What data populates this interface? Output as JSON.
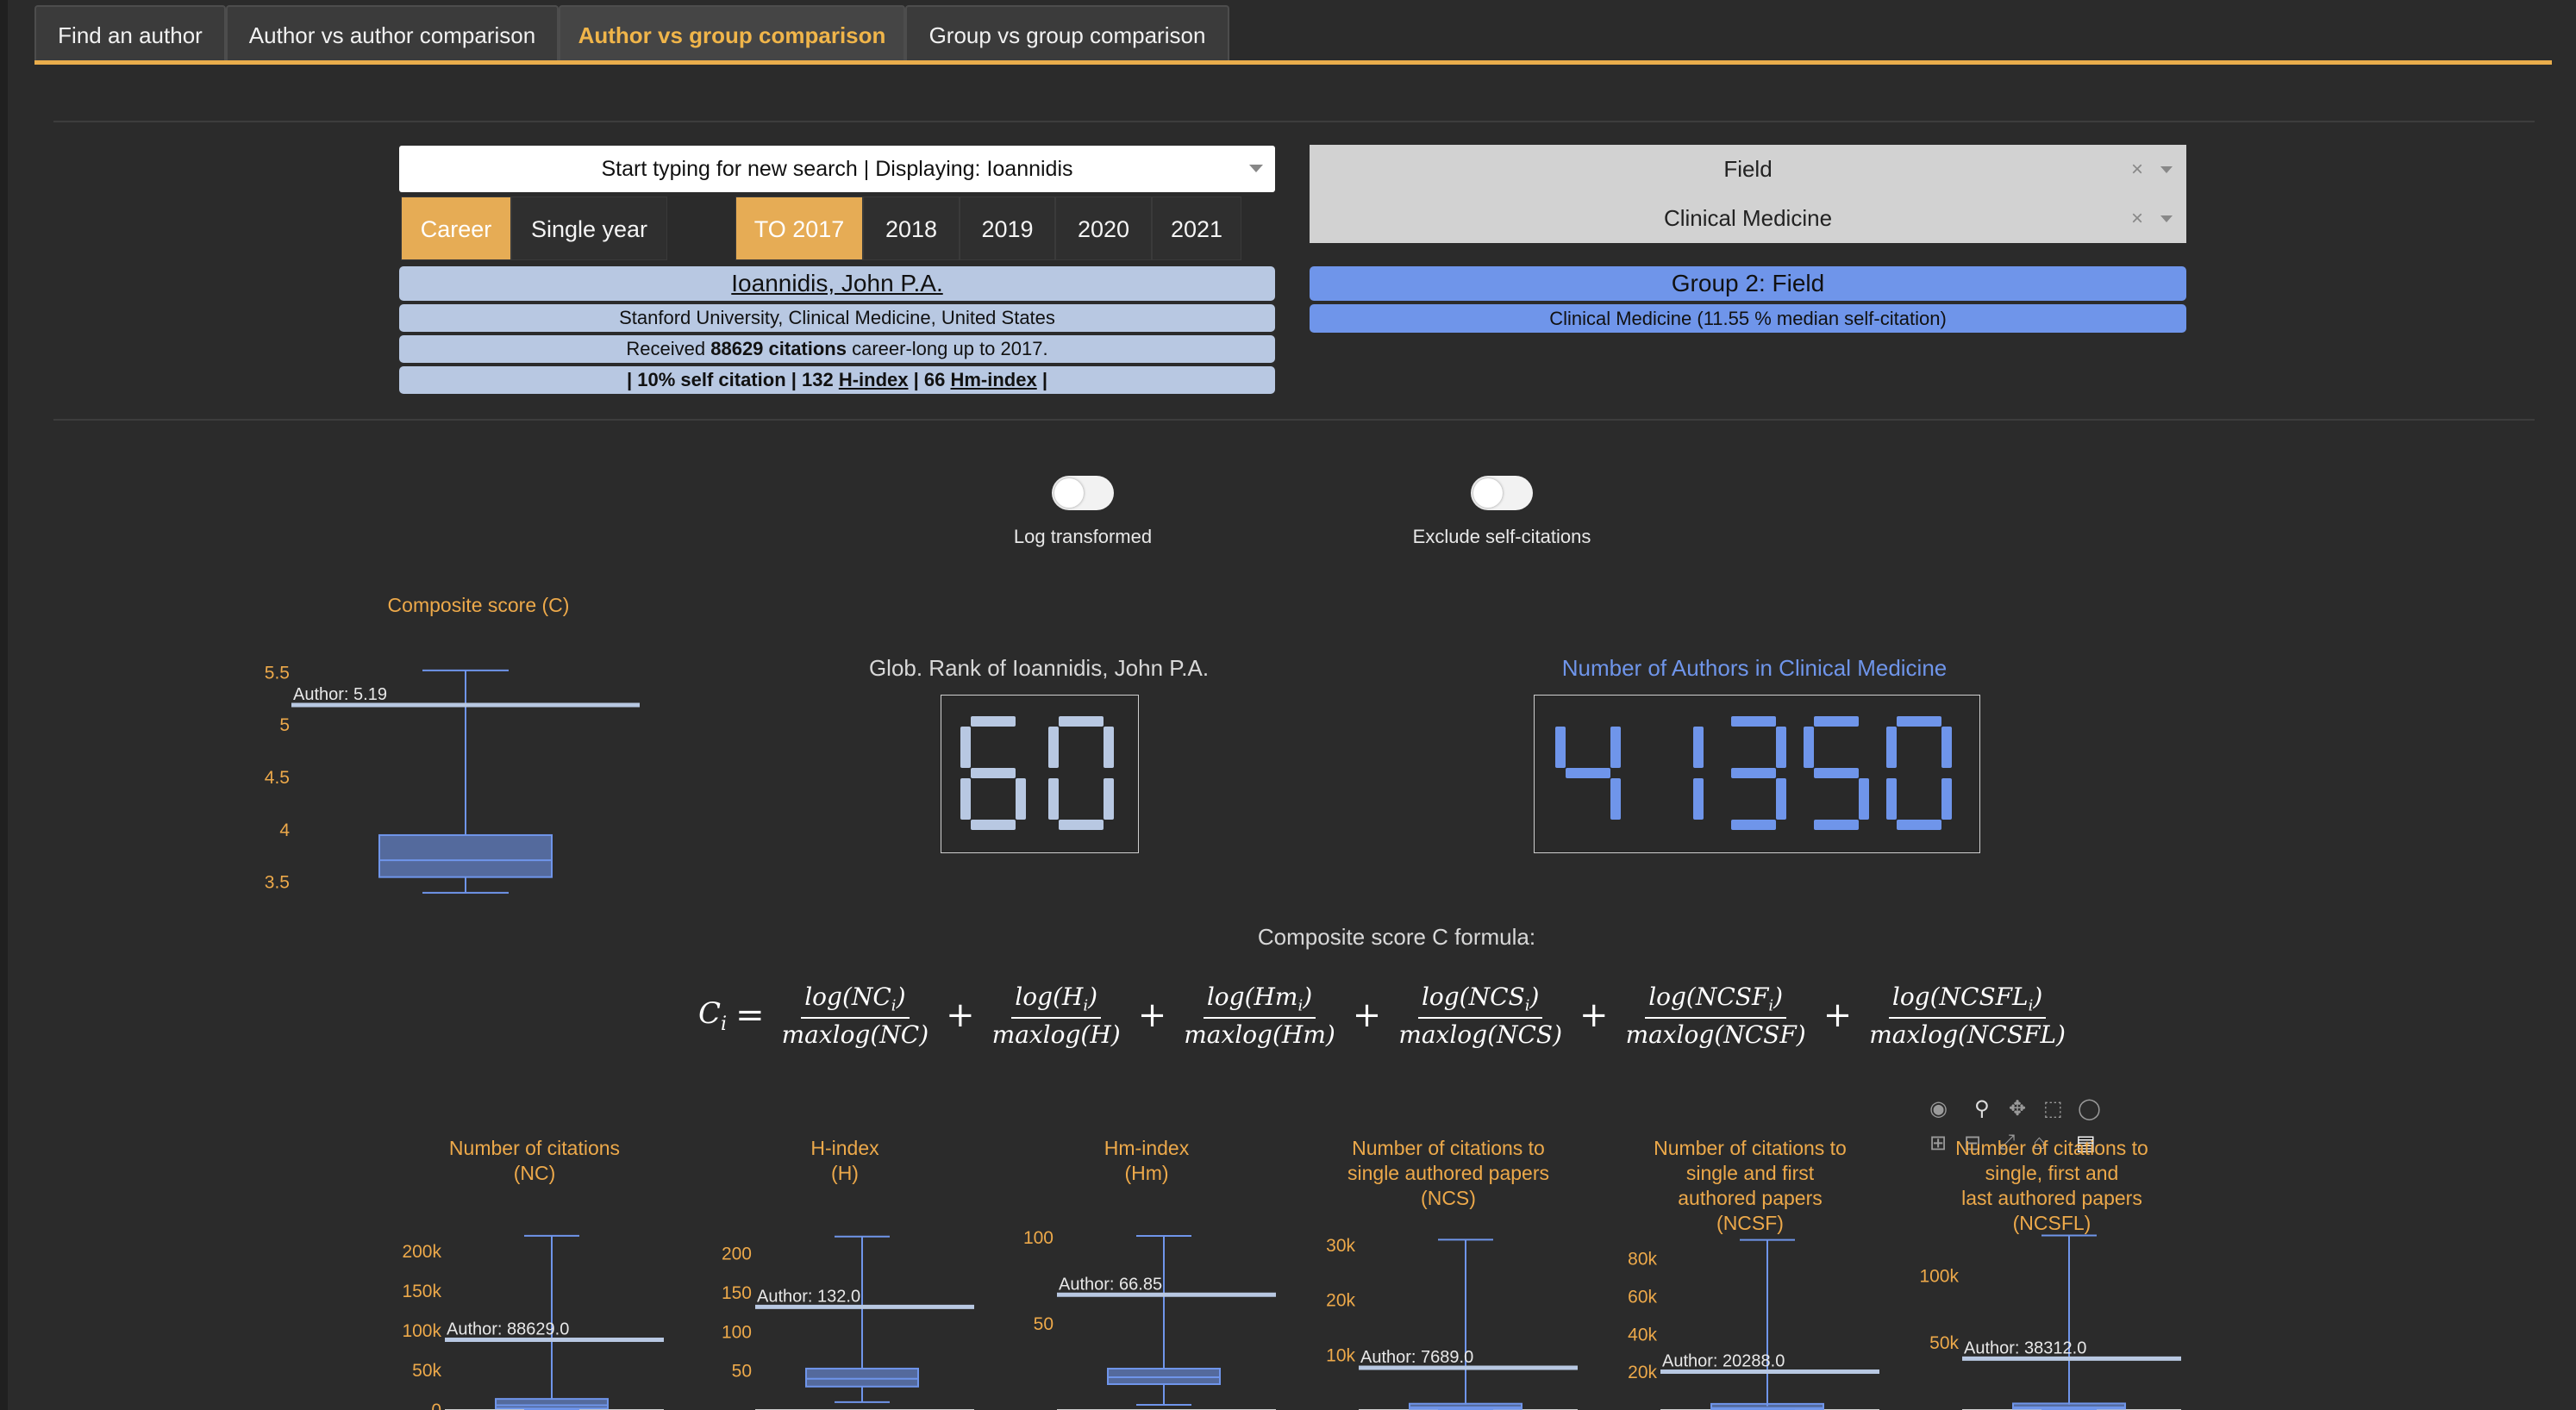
{
  "tabs": [
    "Find an author",
    "Author vs author comparison",
    "Author vs group comparison",
    "Group vs group comparison"
  ],
  "search": {
    "text": "Start typing for new search | Displaying: Ioannidis"
  },
  "mode_buttons": [
    "Career",
    "Single year"
  ],
  "year_buttons": [
    "TO 2017",
    "2018",
    "2019",
    "2020",
    "2021"
  ],
  "author": {
    "name": "Ioannidis, John P.A.",
    "affiliation": "Stanford University, Clinical Medicine, United States",
    "citations_prefix": "Received ",
    "citations_value": "88629 citations",
    "citations_suffix": " career-long up to 2017.",
    "stats_1": "| 10% self citation | 132 ",
    "stats_h": "H-index",
    "stats_2": " | 66 ",
    "stats_hm": "Hm-index",
    "stats_3": " |"
  },
  "group": {
    "select_1": "Field",
    "select_2": "Clinical Medicine",
    "clear_glyph": "×",
    "title": "Group 2: Field",
    "subtitle": "Clinical Medicine (11.55 % median self-citation)"
  },
  "toggles": {
    "log": "Log transformed",
    "self": "Exclude self-citations"
  },
  "rank": {
    "title": "Glob. Rank of Ioannidis, John P.A.",
    "value": "60"
  },
  "authors_count": {
    "title": "Number of Authors in Clinical Medicine",
    "value": "41350"
  },
  "formula_title": "Composite score C formula:",
  "formula": {
    "lhs": "C",
    "lhs_sub": "i",
    "eq": "=",
    "plus": "+",
    "terms": [
      {
        "num": "log(NC",
        "den": "maxlog(NC)"
      },
      {
        "num": "log(H",
        "den": "maxlog(H)"
      },
      {
        "num": "log(Hm",
        "den": "maxlog(Hm)"
      },
      {
        "num": "log(NCS",
        "den": "maxlog(NCS)"
      },
      {
        "num": "log(NCSF",
        "den": "maxlog(NCSF)"
      },
      {
        "num": "log(NCSFL",
        "den": "maxlog(NCSFL)"
      }
    ],
    "sub": "i",
    "close": ")"
  },
  "colors": {
    "accent": "#e9ad4c",
    "blue": "#6f95ea",
    "lightblue": "#b8c8e2",
    "lcd_light": "#b8c8e2",
    "lcd_blue": "#6f95ea"
  },
  "chart_data": [
    {
      "type": "box",
      "title": "Composite score (C)",
      "yticks": [
        "5.5",
        "5",
        "4.5",
        "4",
        "3.5"
      ],
      "ytick_values": [
        5.5,
        5,
        4.5,
        4,
        3.5
      ],
      "ylim": [
        3.35,
        5.65
      ],
      "box": {
        "min": 3.4,
        "q1": 3.55,
        "median": 3.71,
        "q3": 3.95,
        "max": 5.52
      },
      "author": 5.19,
      "author_label": "Author: 5.19"
    },
    {
      "type": "box",
      "title": "Number of citations\n(NC)",
      "yticks": [
        "200k",
        "150k",
        "100k",
        "50k",
        "0"
      ],
      "ytick_values": [
        200000,
        150000,
        100000,
        50000,
        0
      ],
      "ylim": [
        0,
        222000
      ],
      "box": {
        "min": 0,
        "q1": 2000,
        "median": 6000,
        "q3": 14000,
        "max": 220000
      },
      "author": 88629,
      "author_label": "Author: 88629.0"
    },
    {
      "type": "box",
      "title": "H-index\n(H)",
      "yticks": [
        "200",
        "150",
        "100",
        "50"
      ],
      "ytick_values": [
        200,
        150,
        100,
        50
      ],
      "ylim": [
        0,
        225
      ],
      "box": {
        "min": 10,
        "q1": 30,
        "median": 40,
        "q3": 53,
        "max": 222
      },
      "author": 132,
      "author_label": "Author: 132.0"
    },
    {
      "type": "box",
      "title": "Hm-index\n(Hm)",
      "yticks": [
        "100",
        "50"
      ],
      "ytick_values": [
        100,
        50
      ],
      "ylim": [
        0,
        102
      ],
      "box": {
        "min": 3,
        "q1": 15,
        "median": 19,
        "q3": 24,
        "max": 101
      },
      "author": 66.85,
      "author_label": "Author: 66.85"
    },
    {
      "type": "box",
      "title": "Number of citations to\nsingle authored papers\n(NCS)",
      "yticks": [
        "30k",
        "20k",
        "10k"
      ],
      "ytick_values": [
        30000,
        20000,
        10000
      ],
      "ylim": [
        0,
        32000
      ],
      "box": {
        "min": 0,
        "q1": 200,
        "median": 500,
        "q3": 1000,
        "max": 31000
      },
      "author": 7689,
      "author_label": "Author: 7689.0"
    },
    {
      "type": "box",
      "title": "Number of citations to\nsingle and first\nauthored papers\n(NCSF)",
      "yticks": [
        "80k",
        "60k",
        "40k",
        "20k"
      ],
      "ytick_values": [
        80000,
        60000,
        40000,
        20000
      ],
      "ylim": [
        0,
        93000
      ],
      "box": {
        "min": 0,
        "q1": 500,
        "median": 1000,
        "q3": 2000,
        "max": 90000
      },
      "author": 20288,
      "author_label": "Author: 20288.0"
    },
    {
      "type": "box",
      "title": "Number of citations to\nsingle, first and\nlast authored papers\n(NCSFL)",
      "yticks": [
        "100k",
        "50k"
      ],
      "ytick_values": [
        100000,
        50000
      ],
      "ylim": [
        0,
        131000
      ],
      "box": {
        "min": 0,
        "q1": 1000,
        "median": 2000,
        "q3": 4000,
        "max": 130000
      },
      "author": 38312,
      "author_label": "Author: 38312.0"
    }
  ]
}
